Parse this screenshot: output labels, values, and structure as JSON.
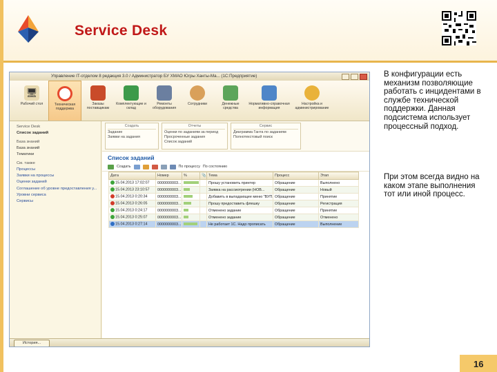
{
  "slide": {
    "title": "Service Desk",
    "page_number": "16",
    "paragraph1": "В конфигурации есть механизм позволяющие работать с инцидентами в службе технической поддержки. Данная подсистема использует процессный подход.",
    "paragraph2": "При этом всегда видно на каком этапе выполнения тот или иной процесс.",
    "accent_color": "#c01818",
    "band_color": "#e8b54c"
  },
  "window": {
    "title": "Управление IT-отделом 8 редакция 3.0 / Администратор БУ ХМАО Югры Ханты-Ма... (1С:Предприятие)"
  },
  "sections": [
    {
      "label": "Рабочий стол",
      "icon": "desktop-icon"
    },
    {
      "label": "Техническая поддержка",
      "icon": "lifebuoy-icon"
    },
    {
      "label": "Заказы поставщикам",
      "icon": "cart-icon"
    },
    {
      "label": "Комплектующие и склад",
      "icon": "board-icon"
    },
    {
      "label": "Ремонты оборудования",
      "icon": "wrench-icon"
    },
    {
      "label": "Сотрудники",
      "icon": "people-icon"
    },
    {
      "label": "Денежные средства",
      "icon": "money-icon"
    },
    {
      "label": "Нормативно-справочная информация",
      "icon": "structure-icon"
    },
    {
      "label": "Настройка и администрирование",
      "icon": "gears-icon"
    }
  ],
  "sidebar": {
    "group1": "Service Desk",
    "item1": "Список заданий",
    "group2": "База знаний",
    "item2": "База знаний",
    "item3": "Тематики",
    "group3": "См. также",
    "links": [
      "Процессы",
      "Заявки на процессы",
      "Оценки заданий",
      "Соглашение об уровне предоставления у...",
      "Уровни сервиса",
      "Сервисы"
    ]
  },
  "toolbar_groups": [
    {
      "header": "Создать",
      "items": [
        "Задание",
        "Заявки на задания"
      ]
    },
    {
      "header": "Отчеты",
      "items": [
        "Оценки по заданиям за период",
        "Просроченные задания",
        "Список заданий"
      ]
    },
    {
      "header": "Сервис",
      "items": [
        "Диаграмма Ганта по заданиям",
        "Полнотекстовый поиск"
      ]
    }
  ],
  "list": {
    "title": "Список заданий",
    "create_label": "Создать",
    "find_label": "По процессу",
    "status_label": "По состоянию",
    "columns": [
      "Дата",
      "Номер",
      "%",
      "",
      "Тема",
      "Процесс",
      "Этап"
    ],
    "rows": [
      {
        "date": "15.04.2013 17:02:07",
        "number": "0000000003...",
        "theme": "Прошу установить принтер",
        "process": "Обращение",
        "stage": "Выполнено",
        "icon_color": "#3ea43a",
        "progress": 1.0
      },
      {
        "date": "15.04.2013 23:10:57",
        "number": "0000000003...",
        "theme": "Заявка на рассмотрении (НОВ...",
        "process": "Обращение",
        "stage": "Новый",
        "icon_color": "#3ea43a",
        "progress": 0.4
      },
      {
        "date": "15.04.2013 0:20:34",
        "number": "0000000003...",
        "theme": "Добавить в выпадающее меню \"ВУП...",
        "process": "Обращение",
        "stage": "Принятие",
        "icon_color": "#d23b2a",
        "progress": 0.6
      },
      {
        "date": "15.04.2013 0:26:05",
        "number": "0000000003...",
        "theme": "Прошу предоставить флешку",
        "process": "Обращение",
        "stage": "Регистрация",
        "icon_color": "#d23b2a",
        "progress": 0.5
      },
      {
        "date": "15.04.2013 0:24:17",
        "number": "0000000003...",
        "theme": "Отменено задание",
        "process": "Обращение",
        "stage": "Принятие",
        "icon_color": "#3ea43a",
        "progress": 0.3
      },
      {
        "date": "15.04.2013 0:25:07",
        "number": "0000000003...",
        "theme": "Отменено задание",
        "process": "Обращение",
        "stage": "Отменено",
        "icon_color": "#3ea43a",
        "progress": 0.3
      },
      {
        "date": "15.04.2013 0:27:14",
        "number": "0000000003...",
        "theme": "Не работает 1С. Надо прописать",
        "process": "Обращение",
        "stage": "Выполнение",
        "icon_color": "#2f6fc4",
        "progress": 0.9
      }
    ]
  },
  "status": {
    "history_button": "История..."
  }
}
